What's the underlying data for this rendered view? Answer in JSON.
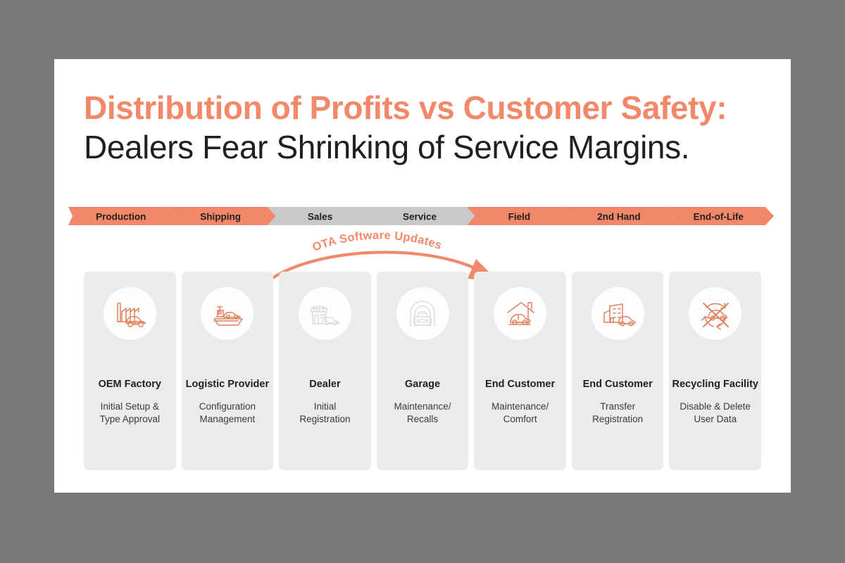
{
  "slide": {
    "title_line1": "Distribution of Profits vs Customer Safety:",
    "title_line2": "Dealers Fear Shrinking of Service Margins.",
    "background_color": "#797979",
    "slide_color": "#ffffff"
  },
  "annotation": {
    "ota_label": "OTA Software Updates",
    "ota_color": "#f1886a"
  },
  "colors": {
    "accent_orange": "#f1886a",
    "chevron_orange": "#f1886a",
    "chevron_grey": "#c9c9c9",
    "card_grey": "#ebebeb",
    "icon_grey": "#d8d8d8",
    "text_dark": "#231f20"
  },
  "lifecycle": {
    "stages": [
      {
        "stage": "Production",
        "org": "OEM Factory",
        "activity": "Initial Setup &\nType Approval",
        "icon": "factory-car-icon",
        "highlighted": true
      },
      {
        "stage": "Shipping",
        "org": "Logistic Provider",
        "activity": "Configuration\nManagement",
        "icon": "cargo-ship-car-icon",
        "highlighted": true
      },
      {
        "stage": "Sales",
        "org": "Dealer",
        "activity": "Initial\nRegistration",
        "icon": "dealership-shop-car-icon",
        "highlighted": false
      },
      {
        "stage": "Service",
        "org": "Garage",
        "activity": "Maintenance/\nRecalls",
        "icon": "garage-car-icon",
        "highlighted": false
      },
      {
        "stage": "Field",
        "org": "End Customer",
        "activity": "Maintenance/\nComfort",
        "icon": "house-car-icon",
        "highlighted": true
      },
      {
        "stage": "2nd Hand",
        "org": "End Customer",
        "activity": "Transfer\nRegistration",
        "icon": "used-car-lot-icon",
        "highlighted": true
      },
      {
        "stage": "End-of-Life",
        "org": "Recycling Facility",
        "activity": "Disable & Delete\nUser Data",
        "icon": "crossed-out-car-icon",
        "highlighted": true
      }
    ]
  }
}
